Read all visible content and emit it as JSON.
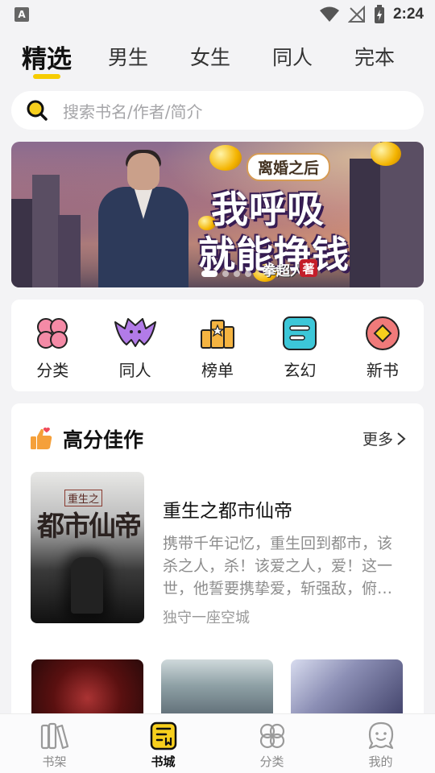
{
  "status_bar": {
    "time": "2:24",
    "app_icon_letter": "A"
  },
  "top_tabs": [
    {
      "label": "精选",
      "active": true
    },
    {
      "label": "男生",
      "active": false
    },
    {
      "label": "女生",
      "active": false
    },
    {
      "label": "同人",
      "active": false
    },
    {
      "label": "完本",
      "active": false
    }
  ],
  "search": {
    "placeholder": "搜索书名/作者/简介",
    "icon": "search-icon"
  },
  "banner": {
    "tag": "离婚之后",
    "title_line1": "我呼吸",
    "title_line2": "就能挣钱",
    "author": "拳超人",
    "seal": "著",
    "slide_count": 4,
    "active_slide": 1
  },
  "categories": [
    {
      "label": "分类",
      "icon": "clover-icon",
      "color": "#f48aa6"
    },
    {
      "label": "同人",
      "icon": "bat-icon",
      "color": "#b27be8"
    },
    {
      "label": "榜单",
      "icon": "ranking-icon",
      "color": "#f5b441"
    },
    {
      "label": "玄幻",
      "icon": "scroll-icon",
      "color": "#3cc7d8"
    },
    {
      "label": "新书",
      "icon": "diamond-badge-icon",
      "color": "#f07a7a"
    }
  ],
  "recommend": {
    "title": "高分佳作",
    "more_label": "更多",
    "featured": {
      "name": "重生之都市仙帝",
      "description": "携带千年记忆，重生回到都市，该杀之人，杀！该爱之人，爱！这一世，他誓要携挚爱，斩强敌，俯…",
      "author": "独守一座空城",
      "cover_title": "都市仙帝",
      "cover_sub": "重生之"
    }
  },
  "bottom_nav": [
    {
      "label": "书架",
      "icon": "bookshelf-icon",
      "active": false
    },
    {
      "label": "书城",
      "icon": "bookstore-icon",
      "active": true
    },
    {
      "label": "分类",
      "icon": "category-icon",
      "active": false
    },
    {
      "label": "我的",
      "icon": "profile-icon",
      "active": false
    }
  ]
}
